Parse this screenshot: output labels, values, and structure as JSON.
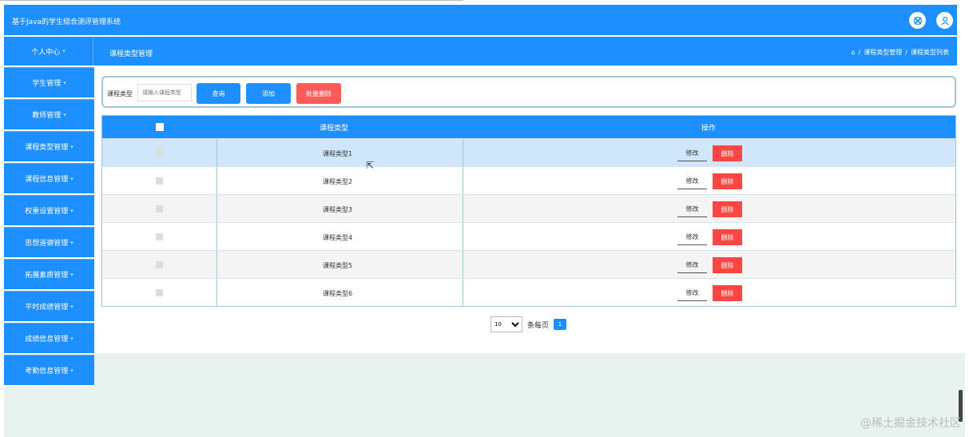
{
  "app": {
    "title": "基于Java的学生综合测评管理系统"
  },
  "nav": {
    "home": "个人中心",
    "page_title": "课程类型管理",
    "breadcrumb": [
      "课程类型管理",
      "/",
      "课程类型列表"
    ]
  },
  "sidebar": {
    "items": [
      {
        "label": "学生管理"
      },
      {
        "label": "教师管理"
      },
      {
        "label": "课程类型管理"
      },
      {
        "label": "课程信息管理"
      },
      {
        "label": "权重设置管理"
      },
      {
        "label": "思想道德管理"
      },
      {
        "label": "拓展素质管理"
      },
      {
        "label": "平时成绩管理"
      },
      {
        "label": "成绩信息管理"
      },
      {
        "label": "考勤信息管理"
      }
    ]
  },
  "search": {
    "label": "课程类型",
    "placeholder": "请输入课程类型",
    "query_btn": "查询",
    "add_btn": "添加",
    "batch_delete_btn": "批量删除"
  },
  "table": {
    "columns": [
      "课程类型",
      "操作"
    ],
    "rows": [
      {
        "name": "课程类型1"
      },
      {
        "name": "课程类型2"
      },
      {
        "name": "课程类型3"
      },
      {
        "name": "课程类型4"
      },
      {
        "name": "课程类型5"
      },
      {
        "name": "课程类型6"
      }
    ],
    "edit_label": "修改",
    "delete_label": "删除"
  },
  "pager": {
    "page_size": "10",
    "total_text": "条每页",
    "current_page": "1"
  },
  "watermark": "@稀土掘金技术社区",
  "colors": {
    "primary": "#1e8fff",
    "danger": "#ff5a5a"
  }
}
